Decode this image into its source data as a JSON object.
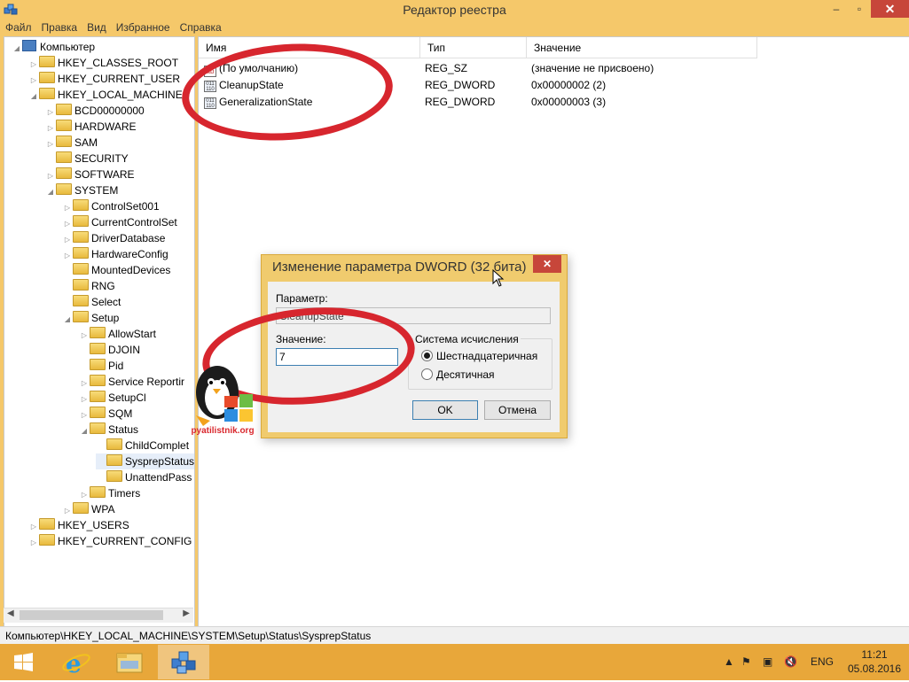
{
  "window": {
    "title": "Редактор реестра",
    "minimize": "–",
    "maximize": "▫",
    "close": "✕"
  },
  "menu": [
    "Файл",
    "Правка",
    "Вид",
    "Избранное",
    "Справка"
  ],
  "tree": {
    "items": [
      {
        "label": "Компьютер",
        "indent": 0,
        "expander": "◢",
        "icon": "computer-icon"
      },
      {
        "label": "HKEY_CLASSES_ROOT",
        "indent": 1,
        "expander": "▷"
      },
      {
        "label": "HKEY_CURRENT_USER",
        "indent": 1,
        "expander": "▷"
      },
      {
        "label": "HKEY_LOCAL_MACHINE",
        "indent": 1,
        "expander": "◢"
      },
      {
        "label": "BCD00000000",
        "indent": 2,
        "expander": "▷"
      },
      {
        "label": "HARDWARE",
        "indent": 2,
        "expander": "▷"
      },
      {
        "label": "SAM",
        "indent": 2,
        "expander": "▷"
      },
      {
        "label": "SECURITY",
        "indent": 2,
        "expander": ""
      },
      {
        "label": "SOFTWARE",
        "indent": 2,
        "expander": "▷"
      },
      {
        "label": "SYSTEM",
        "indent": 2,
        "expander": "◢"
      },
      {
        "label": "ControlSet001",
        "indent": 3,
        "expander": "▷"
      },
      {
        "label": "CurrentControlSet",
        "indent": 3,
        "expander": "▷"
      },
      {
        "label": "DriverDatabase",
        "indent": 3,
        "expander": "▷"
      },
      {
        "label": "HardwareConfig",
        "indent": 3,
        "expander": "▷"
      },
      {
        "label": "MountedDevices",
        "indent": 3,
        "expander": ""
      },
      {
        "label": "RNG",
        "indent": 3,
        "expander": ""
      },
      {
        "label": "Select",
        "indent": 3,
        "expander": ""
      },
      {
        "label": "Setup",
        "indent": 3,
        "expander": "◢"
      },
      {
        "label": "AllowStart",
        "indent": 4,
        "expander": "▷"
      },
      {
        "label": "DJOIN",
        "indent": 4,
        "expander": ""
      },
      {
        "label": "Pid",
        "indent": 4,
        "expander": ""
      },
      {
        "label": "Service Reportir",
        "indent": 4,
        "expander": "▷"
      },
      {
        "label": "SetupCl",
        "indent": 4,
        "expander": "▷"
      },
      {
        "label": "SQM",
        "indent": 4,
        "expander": "▷"
      },
      {
        "label": "Status",
        "indent": 4,
        "expander": "◢"
      },
      {
        "label": "ChildComplet",
        "indent": 5,
        "expander": ""
      },
      {
        "label": "SysprepStatus",
        "indent": 5,
        "expander": "",
        "selected": true
      },
      {
        "label": "UnattendPass",
        "indent": 5,
        "expander": ""
      },
      {
        "label": "Timers",
        "indent": 4,
        "expander": "▷"
      },
      {
        "label": "WPA",
        "indent": 3,
        "expander": "▷"
      },
      {
        "label": "HKEY_USERS",
        "indent": 1,
        "expander": "▷"
      },
      {
        "label": "HKEY_CURRENT_CONFIG",
        "indent": 1,
        "expander": "▷"
      }
    ]
  },
  "list": {
    "columns": [
      "Имя",
      "Тип",
      "Значение"
    ],
    "rows": [
      {
        "name": "(По умолчанию)",
        "type": "REG_SZ",
        "value": "(значение не присвоено)",
        "icon": "ab"
      },
      {
        "name": "CleanupState",
        "type": "REG_DWORD",
        "value": "0x00000002 (2)",
        "icon": "011"
      },
      {
        "name": "GeneralizationState",
        "type": "REG_DWORD",
        "value": "0x00000003 (3)",
        "icon": "011"
      }
    ]
  },
  "statusbar": "Компьютер\\HKEY_LOCAL_MACHINE\\SYSTEM\\Setup\\Status\\SysprepStatus",
  "dialog": {
    "title": "Изменение параметра DWORD (32 бита)",
    "close": "✕",
    "param_label": "Параметр:",
    "param_value": "CleanupState",
    "value_label": "Значение:",
    "value_input": "7",
    "base_label": "Система исчисления",
    "radio_hex": "Шестнадцатеричная",
    "radio_dec": "Десятичная",
    "ok": "OK",
    "cancel": "Отмена"
  },
  "watermark": "pyatilistnik.org",
  "taskbar": {
    "lang": "ENG",
    "time": "11:21",
    "date": "05.08.2016"
  },
  "colors": {
    "accent": "#f5c86a",
    "close_red": "#c7463a",
    "annotation_red": "#d7262e",
    "taskbar": "#e8a73a"
  }
}
